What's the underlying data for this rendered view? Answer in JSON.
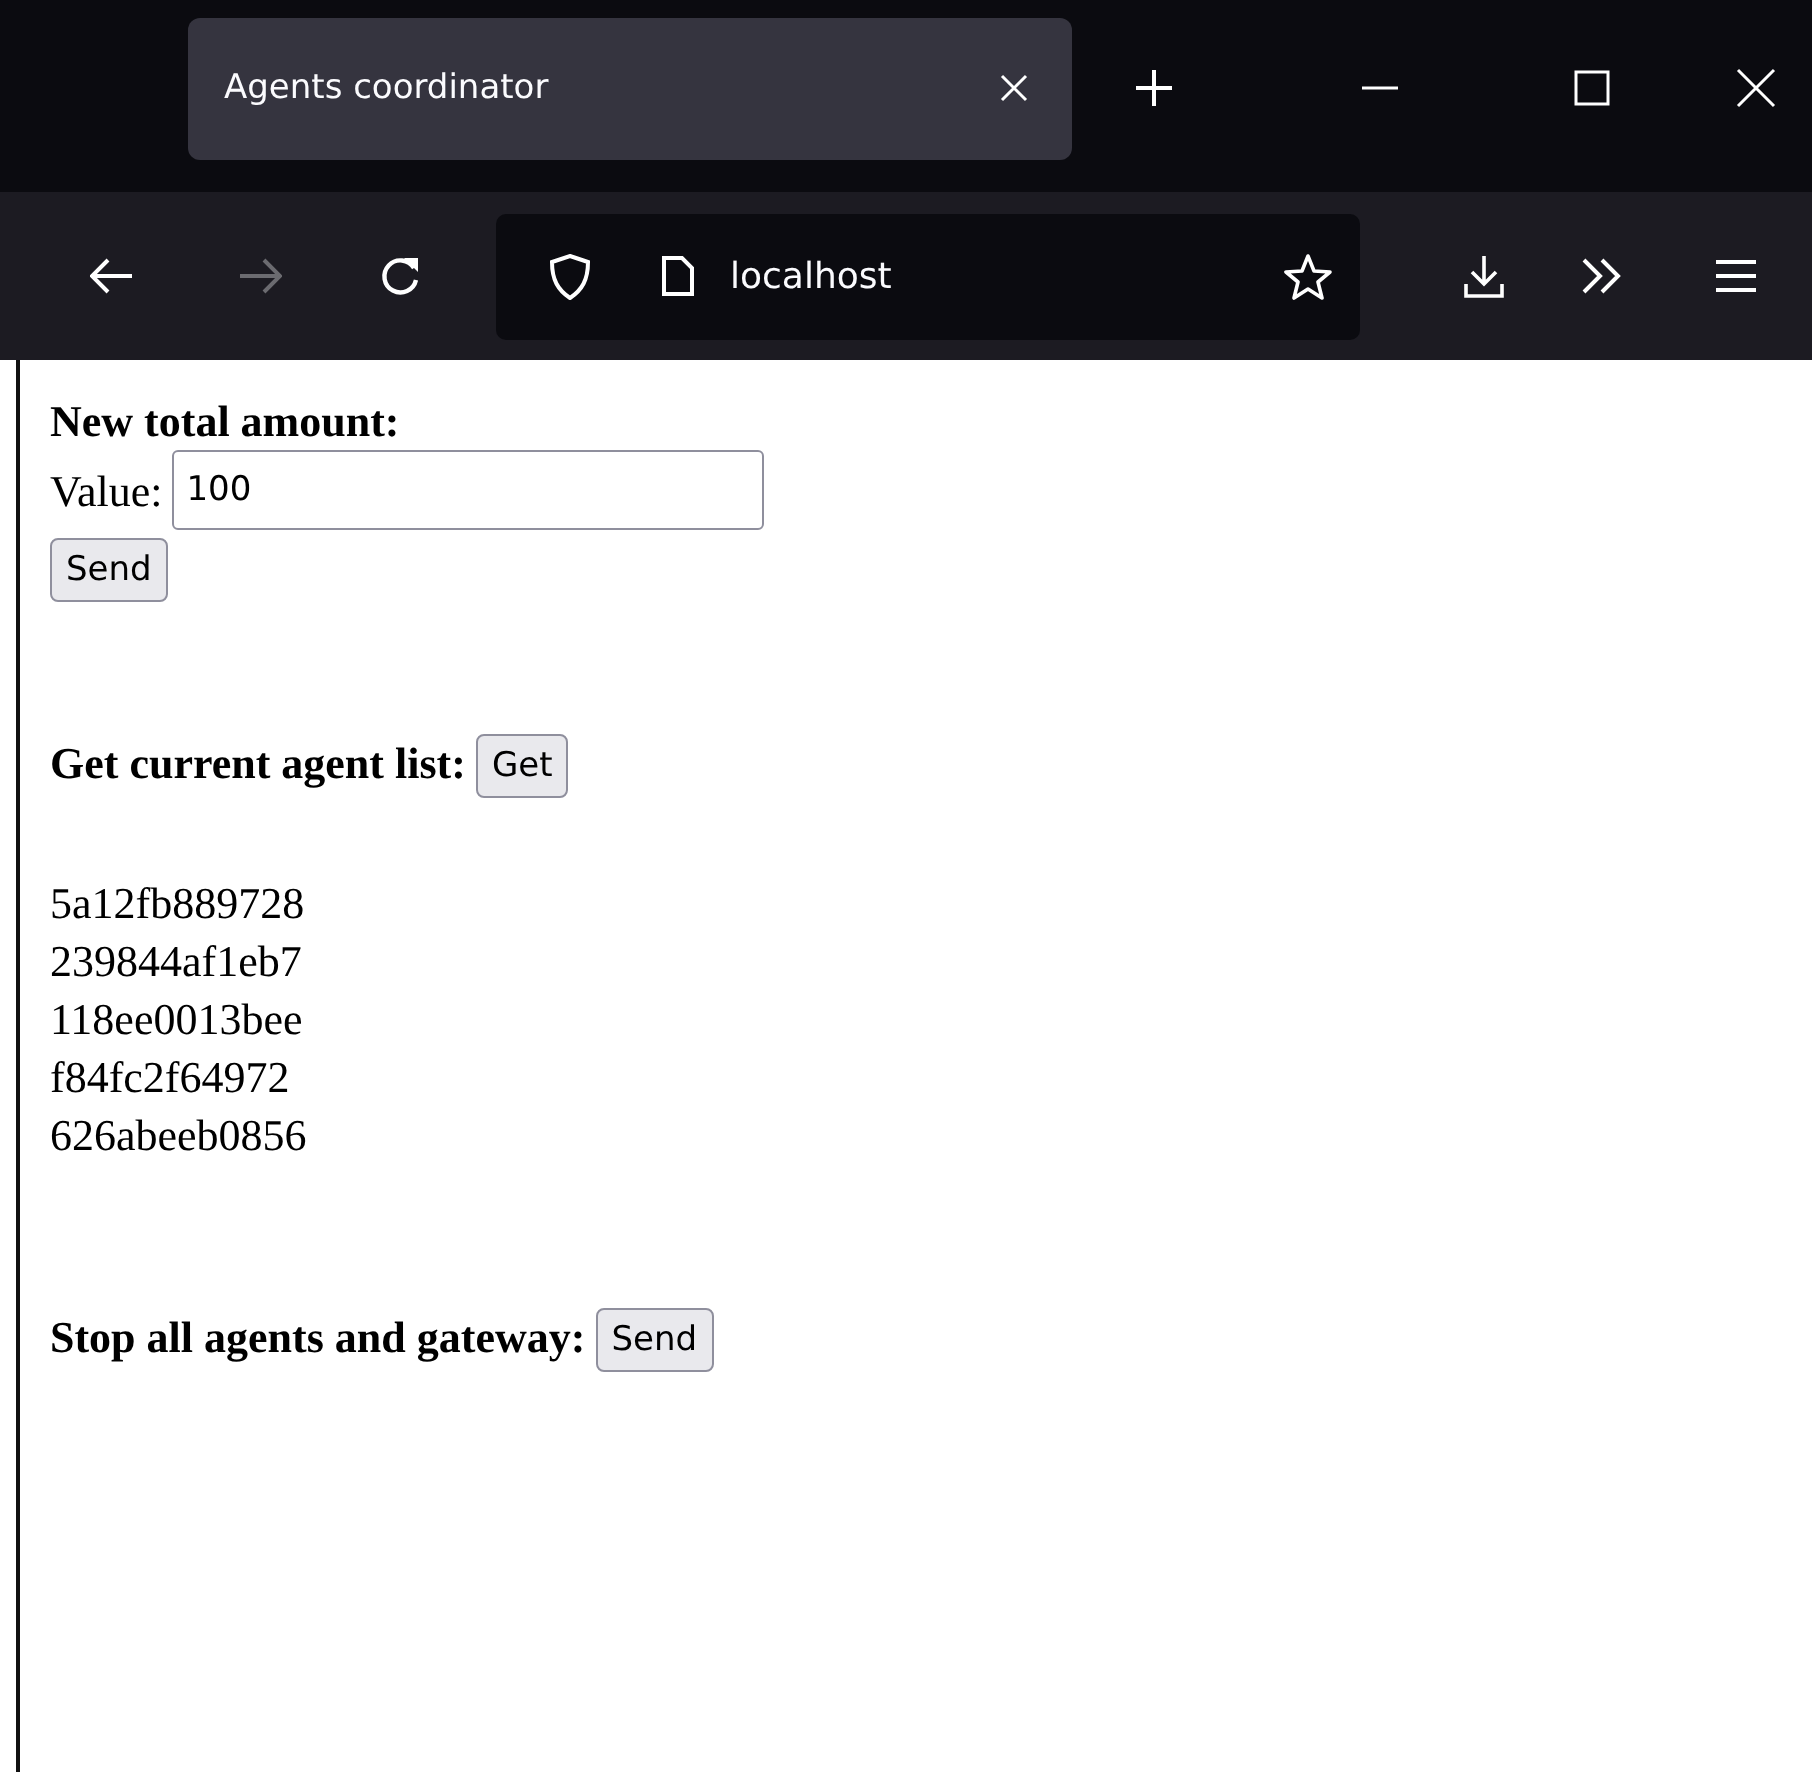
{
  "browser": {
    "tab": {
      "title": "Agents coordinator"
    },
    "forward_disabled": true,
    "address": "localhost"
  },
  "amount_form": {
    "heading": "New total amount:",
    "label": "Value:",
    "value": "100",
    "button": "Send"
  },
  "agent_list": {
    "heading": "Get current agent list:",
    "button": "Get",
    "agents": [
      "5a12fb889728",
      "239844af1eb7",
      "118ee0013bee",
      "f84fc2f64972",
      "626abeeb0856"
    ]
  },
  "stop": {
    "heading": "Stop all agents and gateway:",
    "button": "Send"
  }
}
